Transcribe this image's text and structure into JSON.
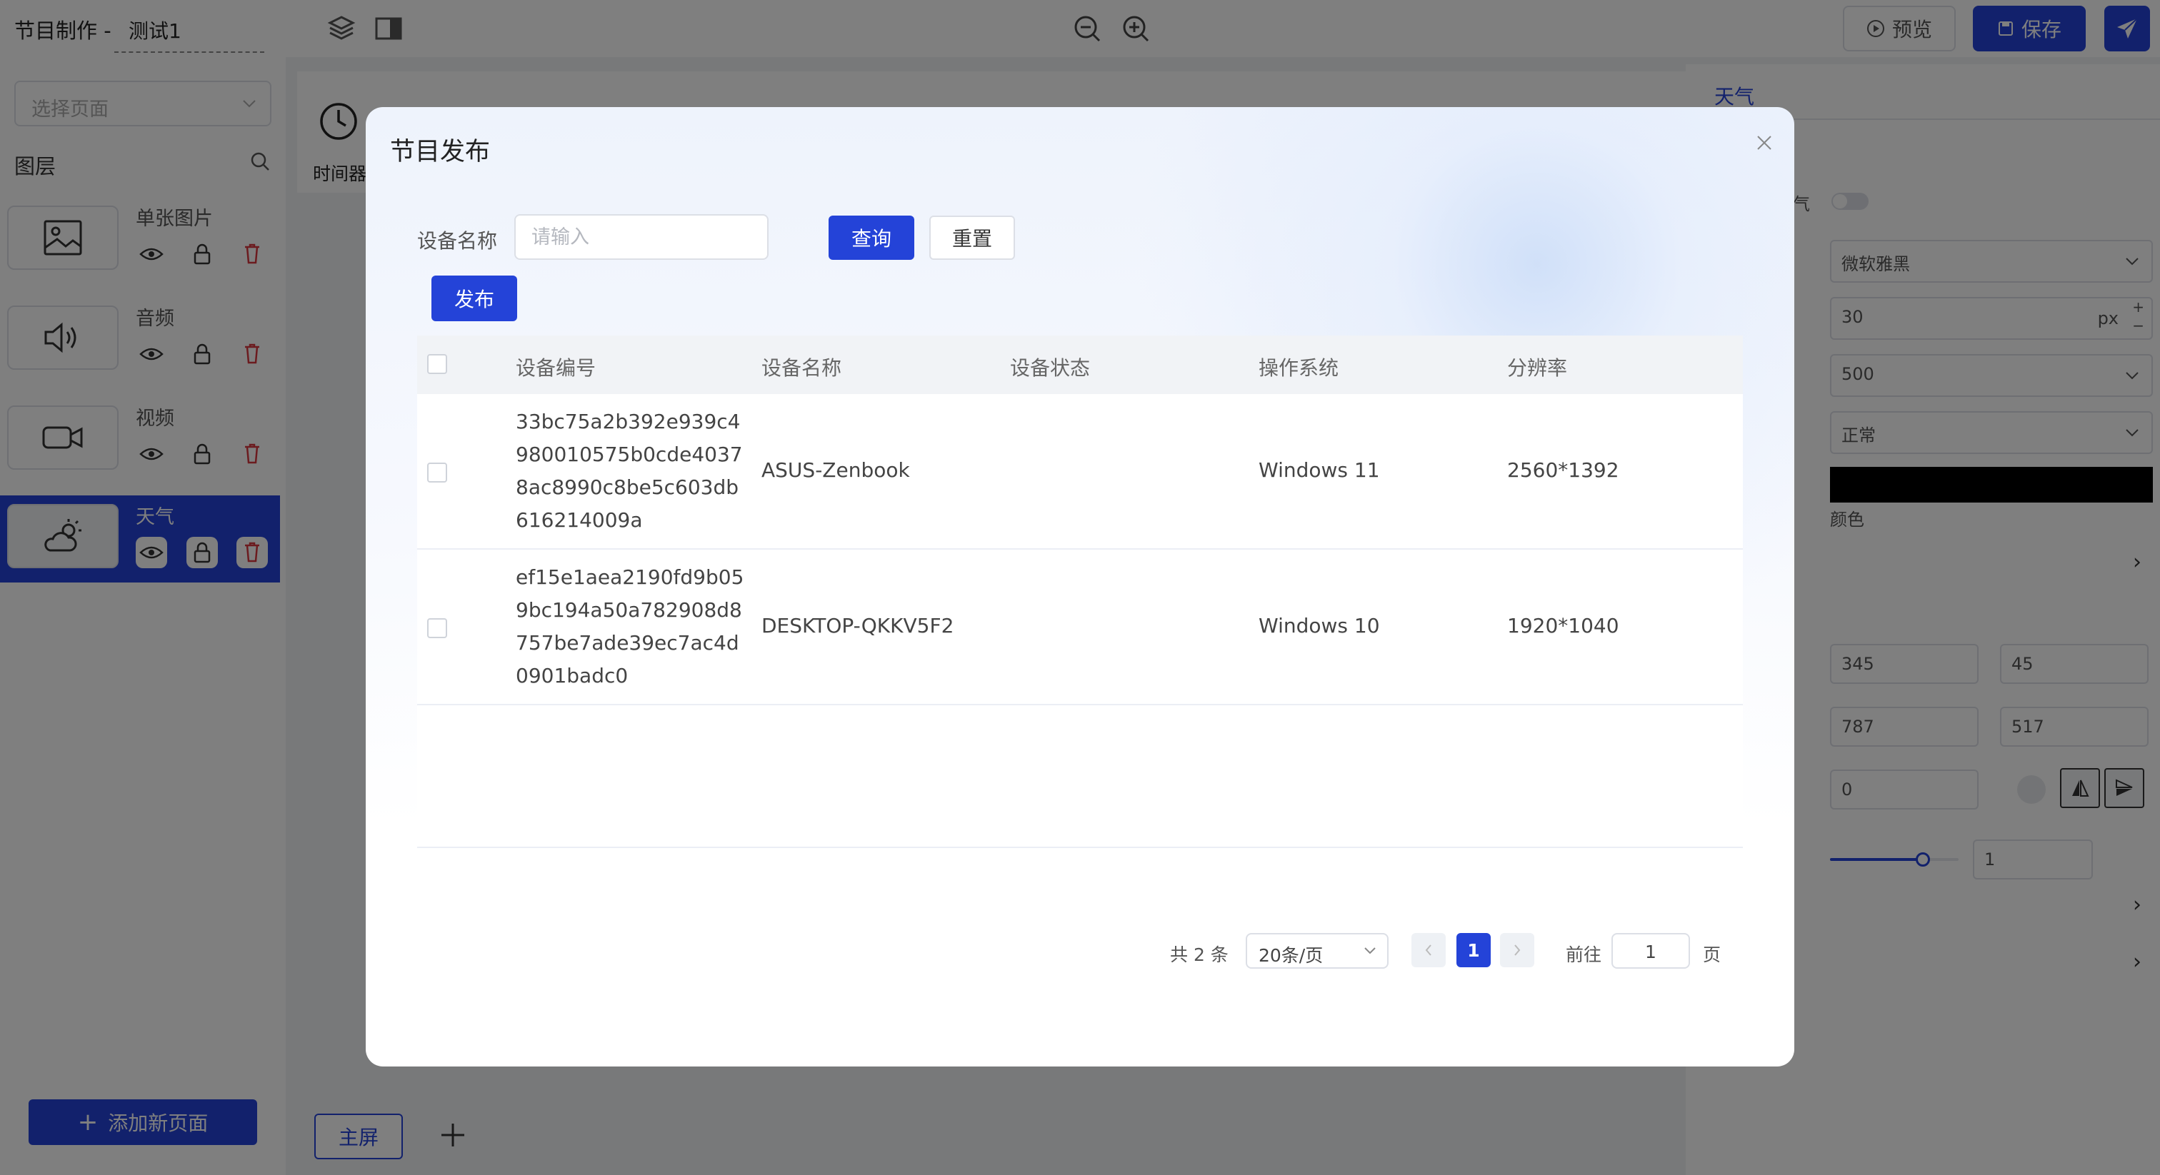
{
  "topbar": {
    "app_title": "节目制作 -",
    "page_name": "测试1",
    "preview_label": "预览",
    "save_label": "保存"
  },
  "left": {
    "page_select_placeholder": "选择页面",
    "layers_title": "图层",
    "layers": [
      {
        "name": "单张图片"
      },
      {
        "name": "音频"
      },
      {
        "name": "视频"
      },
      {
        "name": "天气"
      }
    ],
    "add_page_label": "添加新页面"
  },
  "canvas": {
    "component_label": "时间器",
    "tab_main": "主屏"
  },
  "right": {
    "tab": "天气",
    "toggle_label_fragment": "气",
    "font_family": "微软雅黑",
    "font_size": "30",
    "font_unit": "px",
    "font_weight": "500",
    "font_style": "正常",
    "color_label": "颜色",
    "pos_x": "345",
    "pos_y": "45",
    "width": "787",
    "height": "517",
    "rotate": "0",
    "opacity": "1",
    "slider_level": 0.72
  },
  "dialog": {
    "title": "节目发布",
    "device_name_label": "设备名称",
    "device_name_placeholder": "请输入",
    "query_label": "查询",
    "reset_label": "重置",
    "publish_label": "发布",
    "columns": [
      "设备编号",
      "设备名称",
      "设备状态",
      "操作系统",
      "分辨率"
    ],
    "rows": [
      {
        "id": "33bc75a2b392e939c4980010575b0cde40378ac8990c8be5c603db616214009a",
        "name": "ASUS-Zenbook",
        "status": "",
        "os": "Windows 11",
        "resolution": "2560*1392"
      },
      {
        "id": "ef15e1aea2190fd9b059bc194a50a782908d8757be7ade39ec7ac4d0901badc0",
        "name": "DESKTOP-QKKV5F2",
        "status": "",
        "os": "Windows 10",
        "resolution": "1920*1040"
      }
    ],
    "pagination": {
      "total": "共 2 条",
      "page_size": "20条/页",
      "current": "1",
      "goto_label": "前往",
      "goto_value": "1",
      "page_suffix": "页"
    }
  },
  "colors": {
    "primary": "#2443d8",
    "danger": "#d9363e",
    "overlay": "rgba(0,0,0,0.5)"
  }
}
